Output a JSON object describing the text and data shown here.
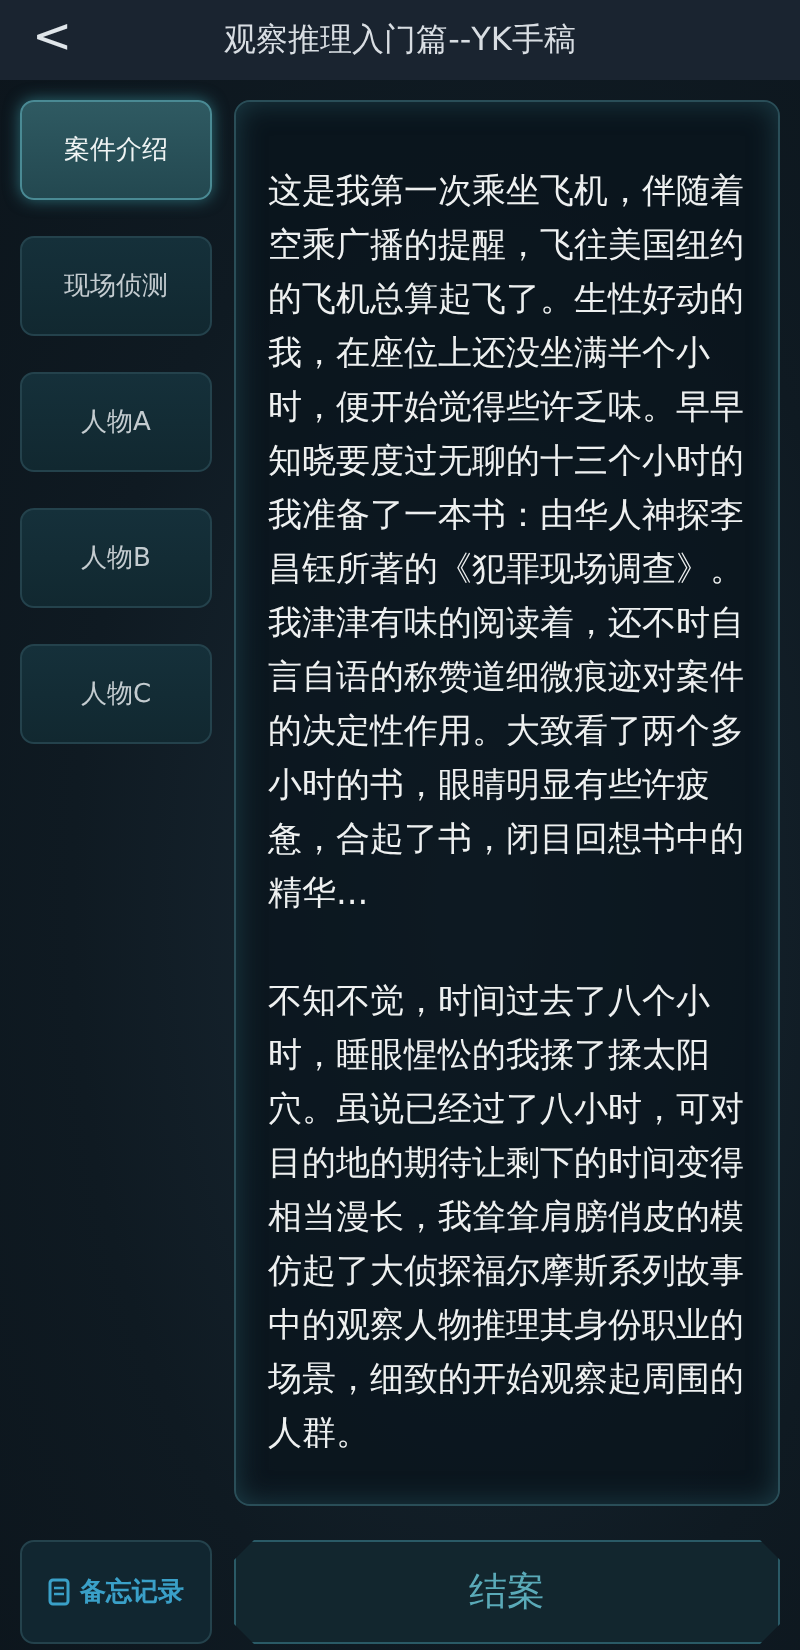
{
  "header": {
    "back": "<",
    "title": "观察推理入门篇--YK手稿"
  },
  "tabs": [
    {
      "label": "案件介绍",
      "selected": true
    },
    {
      "label": "现场侦测",
      "selected": false
    },
    {
      "label": "人物A",
      "selected": false
    },
    {
      "label": "人物B",
      "selected": false
    },
    {
      "label": "人物C",
      "selected": false
    }
  ],
  "paragraphs": [
    "这是我第一次乘坐飞机，伴随着空乘广播的提醒，飞往美国纽约的飞机总算起飞了。生性好动的我，在座位上还没坐满半个小时，便开始觉得些许乏味。早早知晓要度过无聊的十三个小时的我准备了一本书：由华人神探李昌钰所著的《犯罪现场调查》。我津津有味的阅读着，还不时自言自语的称赞道细微痕迹对案件的决定性作用。大致看了两个多小时的书，眼睛明显有些许疲惫，合起了书，闭目回想书中的精华...",
    "不知不觉，时间过去了八个小时，睡眼惺忪的我揉了揉太阳穴。虽说已经过了八小时，可对目的地的期待让剩下的时间变得相当漫长，我耸耸肩膀俏皮的模仿起了大侦探福尔摩斯系列故事中的观察人物推理其身份职业的场景，细致的开始观察起周围的人群。"
  ],
  "memo_button": "备忘记录",
  "conclude_button": "结案"
}
